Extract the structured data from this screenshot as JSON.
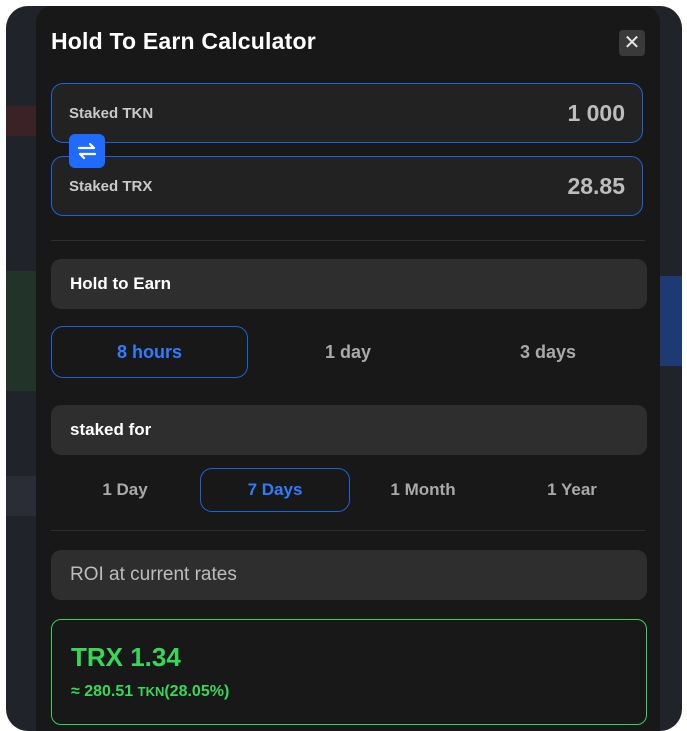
{
  "modal": {
    "title": "Hold To Earn Calculator",
    "close_glyph": "✕"
  },
  "inputs": {
    "staked_tkn": {
      "label": "Staked TKN",
      "value": "1 000"
    },
    "staked_trx": {
      "label": "Staked TRX",
      "value": "28.85"
    },
    "swap_icon": "swap-arrows-icon"
  },
  "hold_to_earn": {
    "heading": "Hold to Earn",
    "options": [
      "8 hours",
      "1 day",
      "3 days"
    ],
    "selected": "8 hours"
  },
  "staked_for": {
    "heading": "staked for",
    "options": [
      "1 Day",
      "7 Days",
      "1 Month",
      "1 Year"
    ],
    "selected": "7 Days"
  },
  "roi": {
    "heading": "ROI at current rates",
    "value": "TRX 1.34",
    "approx_prefix": "≈ 280.51",
    "approx_unit": "TKN",
    "approx_percent": "(28.05%)"
  },
  "colors": {
    "accent_blue": "#1f6bff",
    "roi_green": "#36d85a",
    "modal_bg": "#181818"
  }
}
